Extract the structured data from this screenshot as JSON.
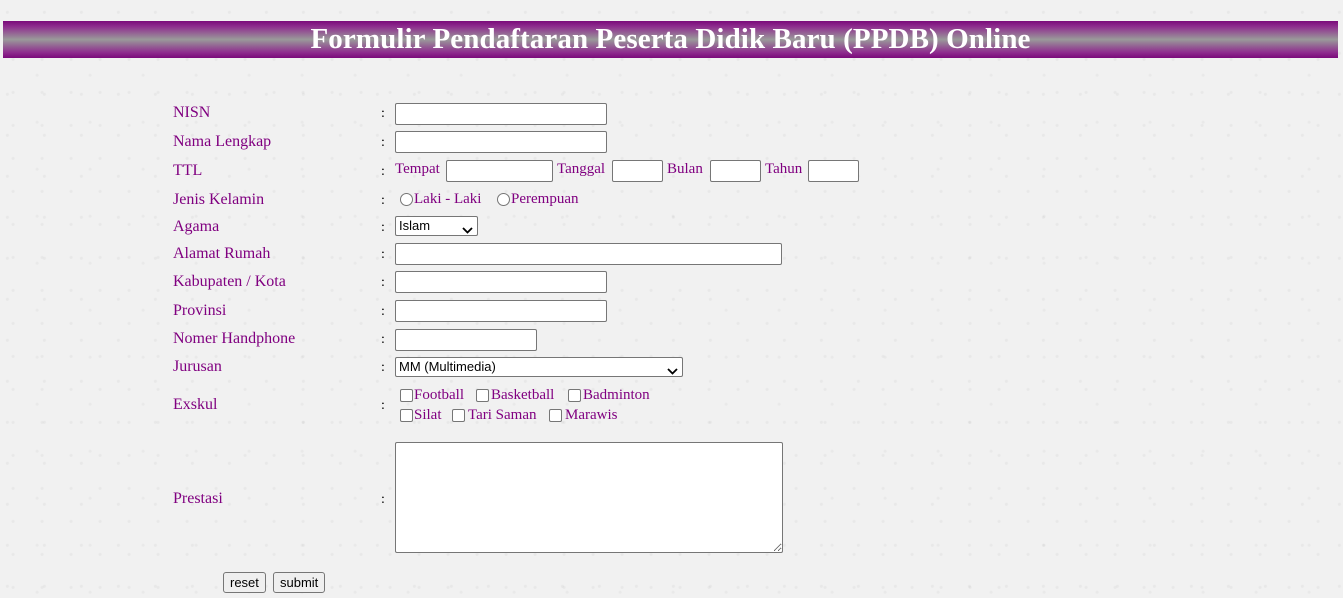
{
  "header": {
    "title": "Formulir Pendaftaran Peserta Didik Baru (PPDB) Online"
  },
  "form": {
    "colon": ":",
    "nisn": {
      "label": "NISN",
      "value": ""
    },
    "nama": {
      "label": "Nama Lengkap",
      "value": ""
    },
    "ttl": {
      "label": "TTL",
      "tempat_label": "Tempat",
      "tanggal_label": "Tanggal",
      "bulan_label": "Bulan",
      "tahun_label": "Tahun"
    },
    "jenis_kelamin": {
      "label": "Jenis Kelamin",
      "options": [
        "Laki - Laki",
        "Perempuan"
      ]
    },
    "agama": {
      "label": "Agama",
      "selected": "Islam"
    },
    "alamat": {
      "label": "Alamat Rumah",
      "value": ""
    },
    "kabupaten": {
      "label": "Kabupaten / Kota",
      "value": ""
    },
    "provinsi": {
      "label": "Provinsi",
      "value": ""
    },
    "handphone": {
      "label": "Nomer Handphone",
      "value": ""
    },
    "jurusan": {
      "label": "Jurusan",
      "selected": "MM (Multimedia)"
    },
    "exskul": {
      "label": "Exskul",
      "options": [
        "Football",
        "Basketball",
        "Badminton",
        "Silat",
        "Tari Saman",
        "Marawis"
      ]
    },
    "prestasi": {
      "label": "Prestasi",
      "value": ""
    },
    "buttons": {
      "reset": "reset",
      "submit": "submit"
    }
  }
}
